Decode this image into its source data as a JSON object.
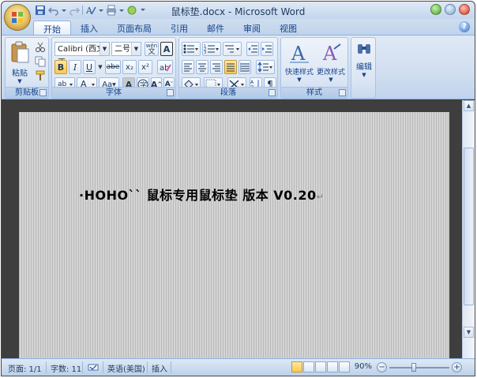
{
  "window": {
    "title": "鼠标垫.docx - Microsoft Word"
  },
  "tabs": [
    {
      "label": "开始",
      "active": true
    },
    {
      "label": "插入"
    },
    {
      "label": "页面布局"
    },
    {
      "label": "引用"
    },
    {
      "label": "邮件"
    },
    {
      "label": "审阅"
    },
    {
      "label": "视图"
    }
  ],
  "ribbon": {
    "clipboard": {
      "label": "剪贴板",
      "paste_label": "粘贴"
    },
    "font": {
      "label": "字体",
      "font_name": "Calibri (西文正",
      "font_size": "二号",
      "bold": "B",
      "italic": "I",
      "underline": "U",
      "strike": "abe",
      "subscript": "x₂",
      "superscript": "x²",
      "change_case": "Aa",
      "grow": "A",
      "shrink": "A",
      "phonetic": "wén",
      "border_char": "A"
    },
    "paragraph": {
      "label": "段落"
    },
    "styles": {
      "label": "样式",
      "quick_styles": "快速样式",
      "change_styles": "更改样式"
    },
    "editing": {
      "label": "编辑",
      "edit": "编辑"
    }
  },
  "document": {
    "text": "·HOHO`` 鼠标专用鼠标垫 版本 V0.20",
    "para_mark": "↵"
  },
  "status": {
    "page": "页面: 1/1",
    "words": "字数: 11",
    "language": "英语(美国)",
    "mode": "插入",
    "zoom": "90%",
    "zoom_value": 90
  },
  "colors": {
    "accent": "#15428b",
    "highlight": "#ffff00",
    "font_color": "#ff0000"
  }
}
